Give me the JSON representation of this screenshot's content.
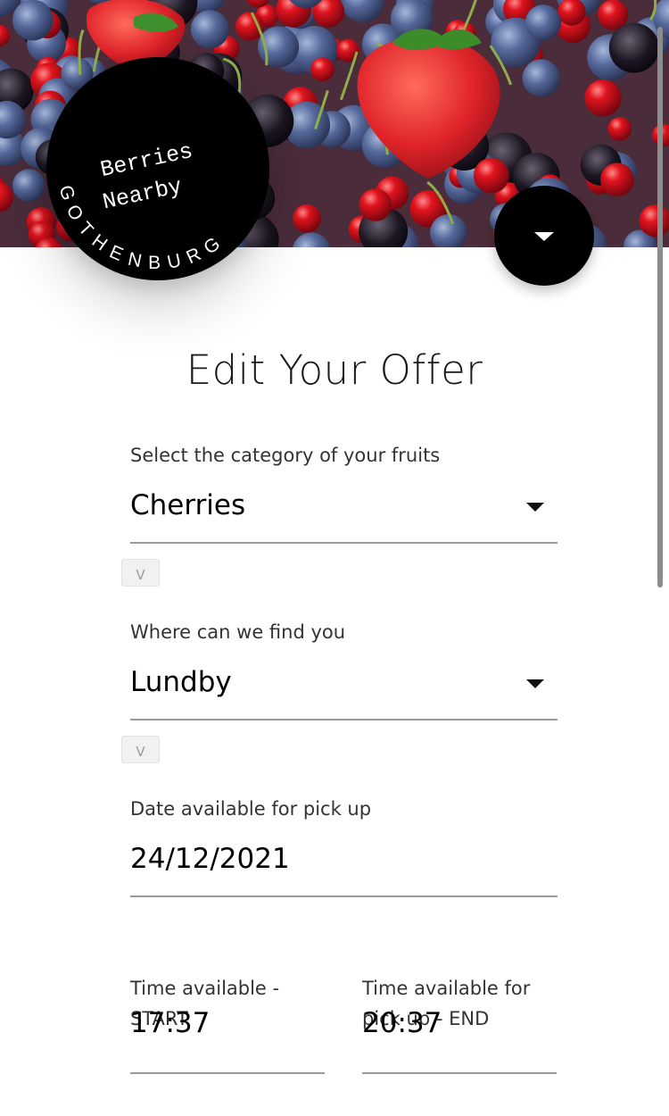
{
  "app": {
    "logo_line1": "Berries",
    "logo_line2": "Nearby",
    "logo_ring": "GOTHENBURG"
  },
  "page": {
    "title": "Edit Your Offer"
  },
  "form": {
    "category": {
      "label": "Select the category of your fruits",
      "value": "Cherries",
      "toggle": "V"
    },
    "location": {
      "label": "Where can we find you",
      "value": "Lundby",
      "toggle": "V"
    },
    "date": {
      "label": "Date available for pick up",
      "value": "24/12/2021"
    },
    "time_start": {
      "label": "Time available - START",
      "value": "17:37"
    },
    "time_end": {
      "label": "Time available for pick up - END",
      "value": "20:37"
    }
  },
  "icons": {
    "menu": "caret-down-icon",
    "dropdown": "caret-down-icon"
  },
  "colors": {
    "badge": "#000000",
    "text": "#111111",
    "underline": "#9a9a9a",
    "strawberry": "#d8262c",
    "blueberry": "#4b5f8e",
    "currant": "#c8102e"
  }
}
